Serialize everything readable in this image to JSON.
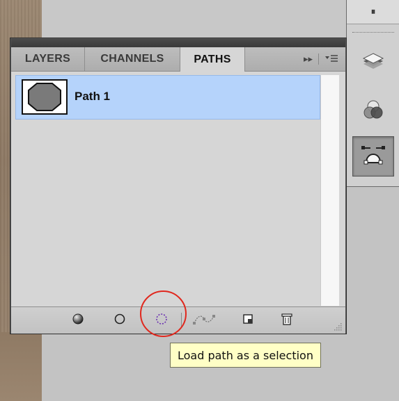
{
  "dock": {
    "top_glyph": "⏸",
    "buttons": [
      {
        "icon": "layers-stack-icon",
        "active": false
      },
      {
        "icon": "channels-rgb-icon",
        "active": false
      },
      {
        "icon": "paths-pen-icon",
        "active": true
      }
    ]
  },
  "panel": {
    "tabs": [
      {
        "label": "LAYERS",
        "active": false
      },
      {
        "label": "CHANNELS",
        "active": false
      },
      {
        "label": "PATHS",
        "active": true
      }
    ],
    "menu_glyph": "▸▸",
    "paths": [
      {
        "name": "Path 1",
        "selected": true
      }
    ],
    "footer_buttons": [
      "fill-path-icon",
      "stroke-path-icon",
      "load-path-as-selection-icon",
      "make-work-path-icon",
      "new-path-icon",
      "delete-path-icon"
    ]
  },
  "tooltip": {
    "text": "Load path as a selection"
  },
  "colors": {
    "selection": "#b5d3fb",
    "annotation": "#e0281e",
    "tooltip_bg": "#ffffc6"
  }
}
